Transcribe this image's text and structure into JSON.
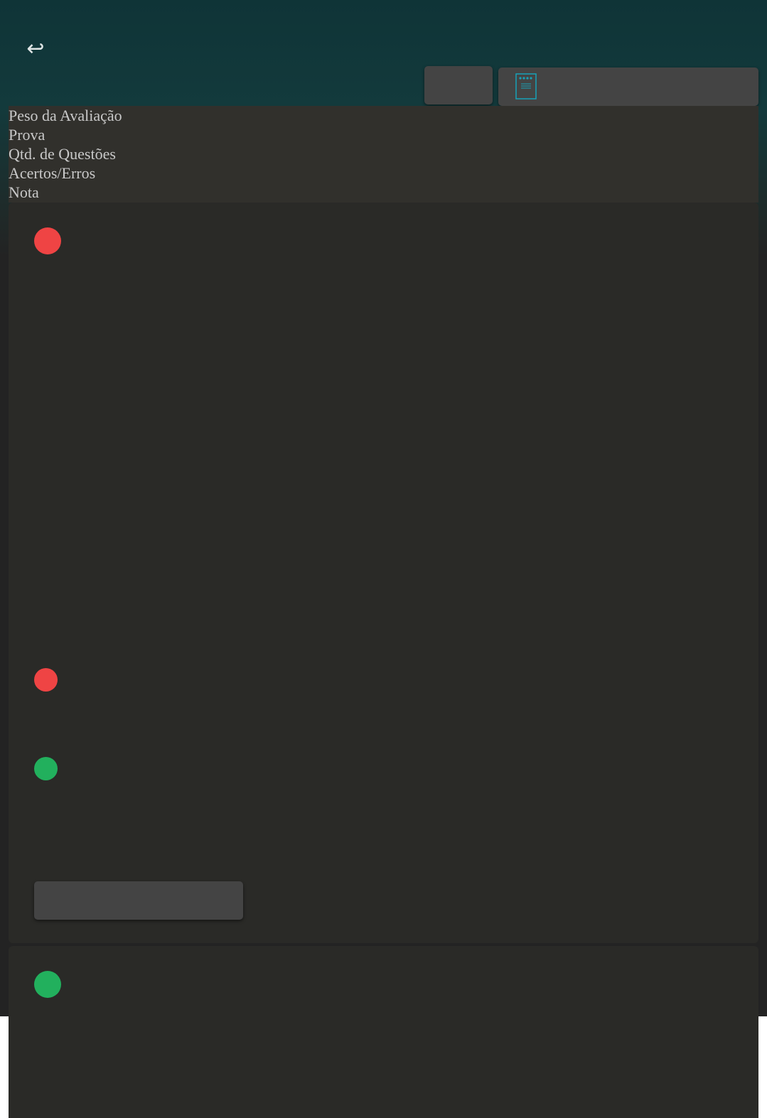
{
  "header": {
    "back_icon": "return-arrow-icon",
    "back_glyph": "↩",
    "doc_icon": "document-icon"
  },
  "info": {
    "lines": [
      "Peso da Avaliação",
      "Prova",
      "Qtd. de Questões",
      "Acertos/Erros",
      "Nota"
    ]
  },
  "cards": [
    {
      "indicators": [
        {
          "status": "incorrect",
          "color": "#ef4444"
        },
        {
          "status": "incorrect",
          "color": "#ef4444"
        },
        {
          "status": "correct",
          "color": "#22b05d"
        }
      ]
    },
    {
      "indicators": [
        {
          "status": "correct",
          "color": "#22b05d"
        }
      ]
    }
  ],
  "colors": {
    "header": "#0f3437",
    "panel": "#2a2a27",
    "info_bg": "#31302c",
    "button": "#444444",
    "accent": "#17a2b8",
    "red": "#ef4444",
    "green": "#22b05d"
  }
}
